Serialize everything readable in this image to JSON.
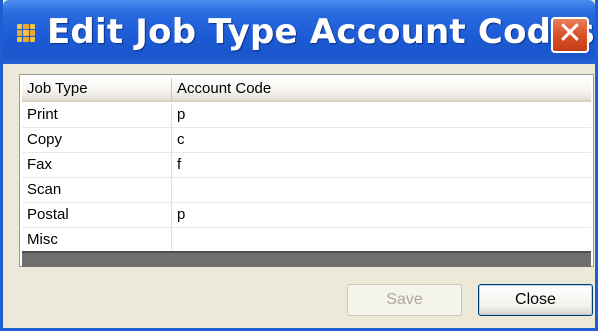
{
  "window": {
    "title": "Edit Job Type Account Codes"
  },
  "grid": {
    "columns": [
      "Job Type",
      "Account Code"
    ],
    "rows": [
      {
        "job_type": "Print",
        "account_code": "p"
      },
      {
        "job_type": "Copy",
        "account_code": "c"
      },
      {
        "job_type": "Fax",
        "account_code": "f"
      },
      {
        "job_type": "Scan",
        "account_code": ""
      },
      {
        "job_type": "Postal",
        "account_code": "p"
      },
      {
        "job_type": "Misc",
        "account_code": ""
      }
    ]
  },
  "buttons": {
    "save": "Save",
    "close": "Close",
    "close_glyph": "✕",
    "save_enabled": false
  },
  "icons": {
    "title_icon": "grid-app-icon",
    "close_icon": "close-icon"
  },
  "colors": {
    "titlebar": "#1d5cd6",
    "close_button": "#d9502a",
    "window_bg": "#ece9d8"
  }
}
